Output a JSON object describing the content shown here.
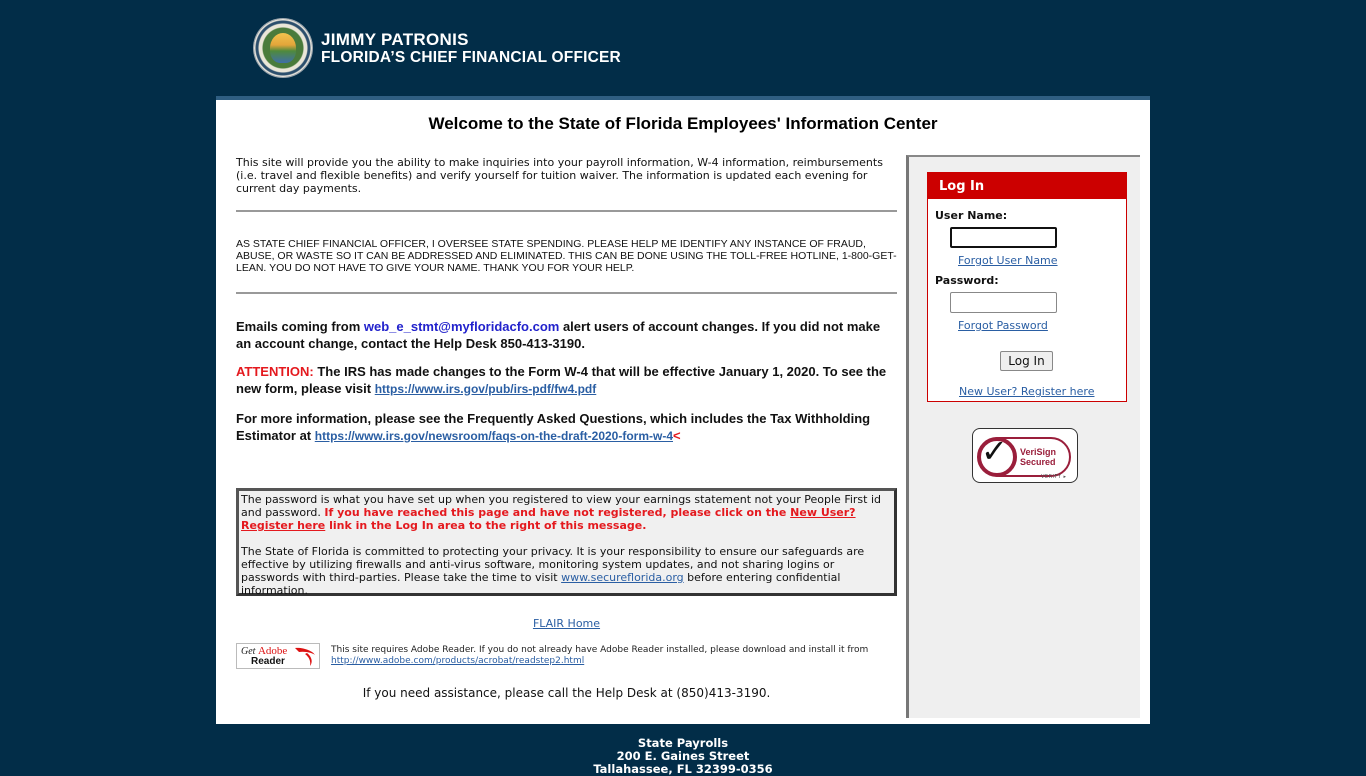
{
  "header": {
    "name": "JIMMY PATRONIS",
    "title": "FLORIDA’S CHIEF FINANCIAL OFFICER",
    "seal_icon": "cfo-seal-icon"
  },
  "main": {
    "welcome": "Welcome to the State of Florida Employees' Information Center",
    "intro": "This site will provide you the ability to make inquiries into your payroll information, W-4 information, reimbursements (i.e. travel and flexible benefits) and verify yourself for tuition waiver. The information is updated each evening for current day payments.",
    "cfo_message": "AS STATE CHIEF FINANCIAL OFFICER, I OVERSEE STATE SPENDING. PLEASE HELP ME IDENTIFY ANY INSTANCE OF FRAUD, ABUSE, OR WASTE SO IT CAN BE ADDRESSED AND ELIMINATED. THIS CAN BE DONE USING THE TOLL-FREE HOTLINE, 1-800-GET-LEAN. YOU DO NOT HAVE TO GIVE YOUR NAME. THANK YOU FOR YOUR HELP.",
    "emails": {
      "prefix": "Emails coming from ",
      "email": "web_e_stmt@myfloridacfo.com",
      "suffix": " alert users of account changes.  If you did not make an account change, contact the Help Desk 850-413-3190."
    },
    "attention": {
      "label": "ATTENTION:",
      "text": " The IRS has made changes to the Form W-4 that will be effective January 1, 2020. To see the new form, please visit ",
      "link": "https://www.irs.gov/pub/irs-pdf/fw4.pdf"
    },
    "faq": {
      "text": "For more information, please see the Frequently Asked Questions, which includes the Tax Withholding Estimator  at  ",
      "link": "https://www.irs.gov/newsroom/faqs-on-the-draft-2020-form-w-4",
      "marker": "<"
    },
    "notice": {
      "p1_plain": "The password is what you have set up when you registered to view your earnings statement not your People First id and password. ",
      "p1_red_a": "If you have reached this page and have not registered, please click on the ",
      "p1_link": "New User? Register here",
      "p1_red_b": " link in the Log In area to the right of this message.",
      "p2_a": "The State of Florida is committed to protecting your privacy. It is your responsibility to ensure our safeguards are effective by utilizing firewalls and anti-virus software, monitoring system updates, and not sharing logins or passwords with third-parties. Please take the time to visit ",
      "p2_link": "www.secureflorida.org",
      "p2_b": " before entering confidential information."
    },
    "flair_link": "FLAIR Home",
    "adobe": {
      "badge_get": "Get ",
      "badge_adobe": "Adobe",
      "badge_reader": "Reader",
      "text": "This site requires Adobe Reader. If you do not already have Adobe Reader installed, please download and install it from ",
      "link": "http://www.adobe.com/products/acrobat/readstep2.html"
    },
    "helpdesk": "If you need assistance, please call the Help Desk at (850)413-3190."
  },
  "login": {
    "title": "Log In",
    "username_label": "User Name:",
    "username_value": "",
    "forgot_username": "Forgot User Name",
    "password_label": "Password:",
    "password_value": "",
    "forgot_password": "Forgot Password",
    "button": "Log In",
    "register": "New User? Register here"
  },
  "verisign": {
    "line1": "VeriSign",
    "line2": "Secured",
    "verify": "VERIFY ▸"
  },
  "footer": {
    "line1": "State Payrolls",
    "line2": "200 E. Gaines Street",
    "line3": "Tallahassee, FL 32399-0356"
  }
}
